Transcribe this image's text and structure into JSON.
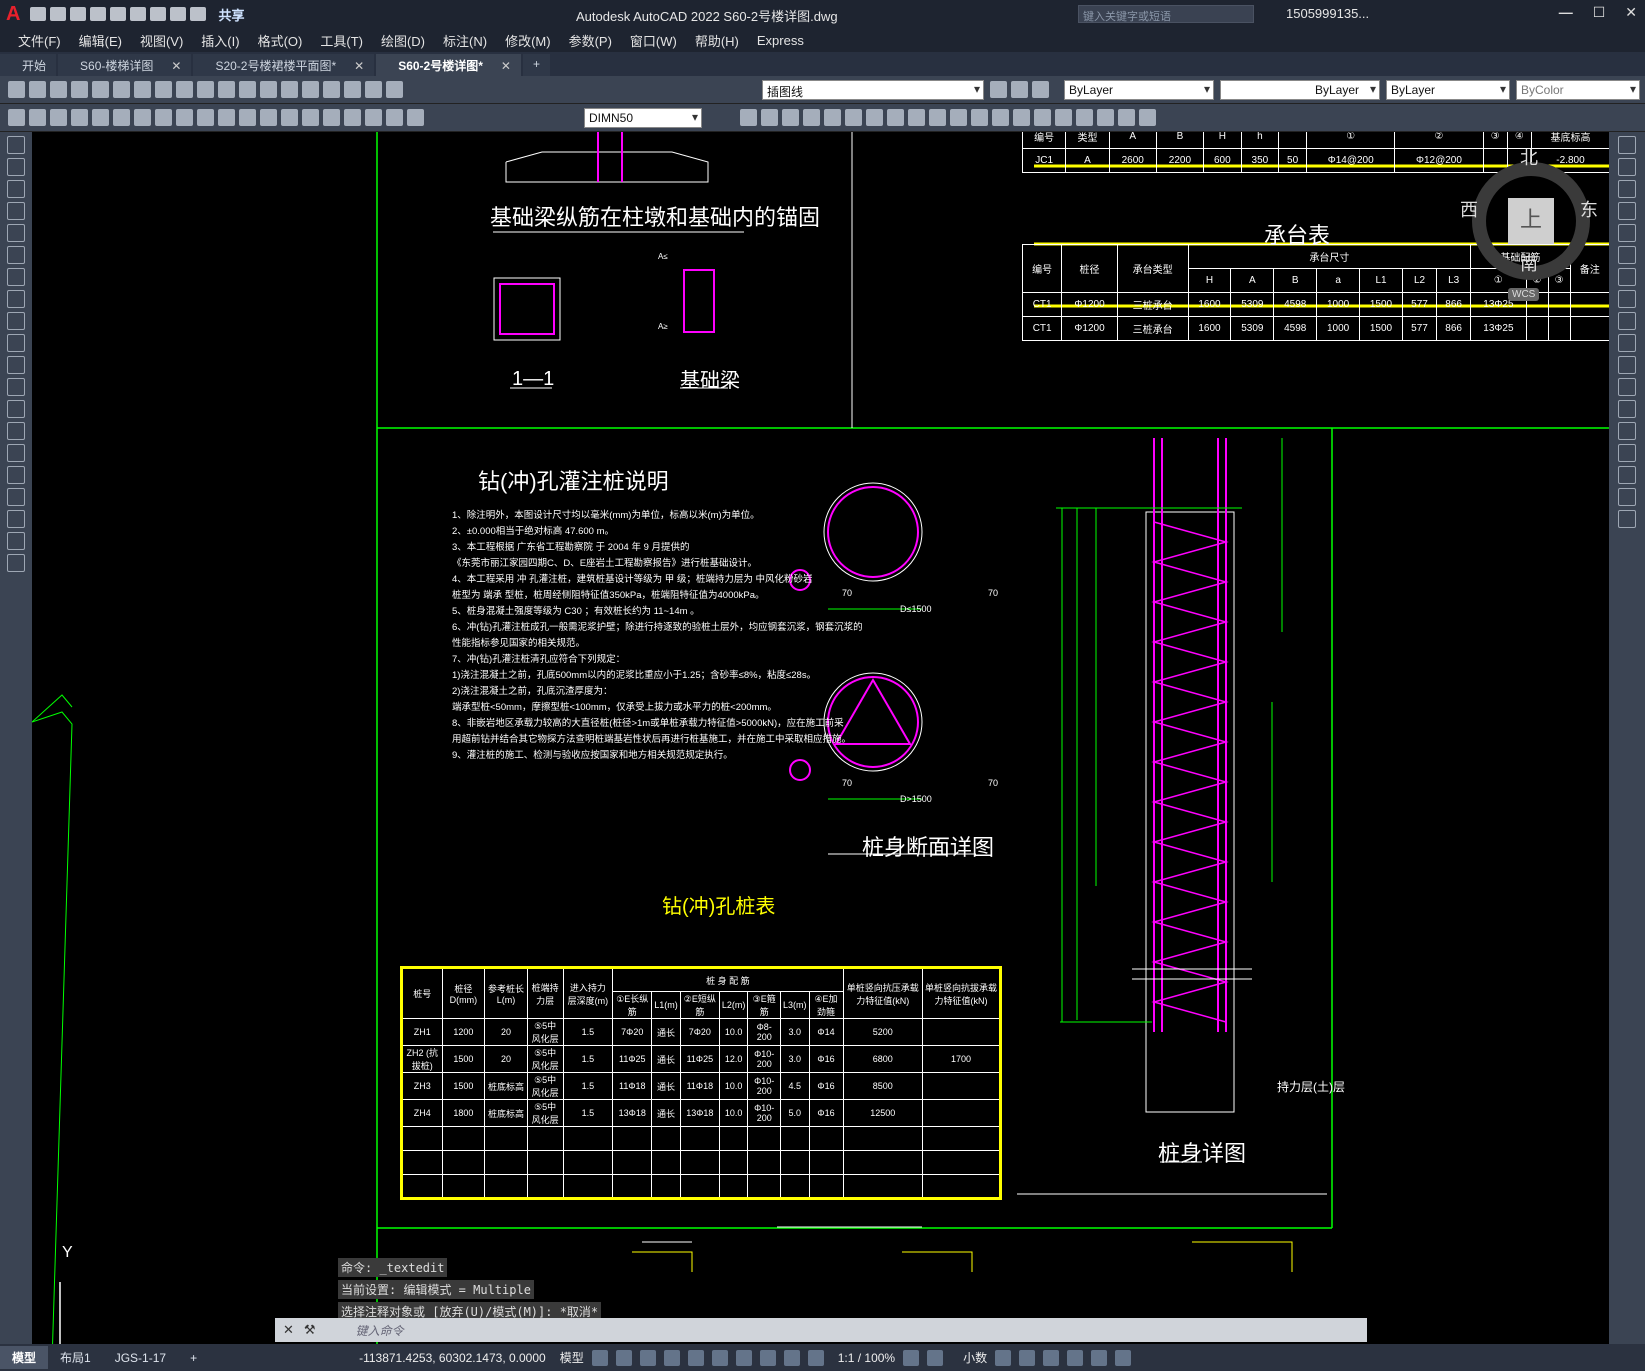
{
  "app": {
    "title": "Autodesk AutoCAD 2022    S60-2号楼详图.dwg",
    "share_label": "共享",
    "search_placeholder": "键入关键字或短语",
    "account": "1505999135...",
    "logo": "A"
  },
  "menu": [
    "文件(F)",
    "编辑(E)",
    "视图(V)",
    "插入(I)",
    "格式(O)",
    "工具(T)",
    "绘图(D)",
    "标注(N)",
    "修改(M)",
    "参数(P)",
    "窗口(W)",
    "帮助(H)",
    "Express"
  ],
  "tabs": [
    {
      "label": "开始"
    },
    {
      "label": "S60-楼梯详图"
    },
    {
      "label": "S20-2号楼裙楼平面图*"
    },
    {
      "label": "S60-2号楼详图*"
    }
  ],
  "toolbar": {
    "layer": "插图线",
    "color": "ByLayer",
    "linetype": "ByLayer",
    "lineweight": "ByLayer",
    "plotstyle": "ByColor",
    "dimstyle": "DIMN50"
  },
  "drawing": {
    "anchor_title": "基础梁纵筋在柱墩和基础内的锚固",
    "section_1": "1—1",
    "base_beam": "基础梁",
    "cap_table_title": "承台表",
    "pile_note_title": "钻(冲)孔灌注桩说明",
    "pile_section_title": "桩身断面详图",
    "pile_table_title": "钻(冲)孔桩表",
    "pile_detail_title": "桩身详图",
    "bearing_layer": "持力层(土)层",
    "d1500a": "D≤1500",
    "d1500b": "D>1500",
    "dim70": "70",
    "mini_a": "A≤",
    "mini_b": "A≥",
    "notes": [
      "1、除注明外，本图设计尺寸均以毫米(mm)为单位，标高以米(m)为单位。",
      "2、±0.000相当于绝对标高 47.600 m。",
      "3、本工程根据 广东省工程勘察院 于 2004 年 9 月提供的",
      "   《东莞市丽江家园四期C、D、E座岩土工程勘察报告》进行桩基础设计。",
      "4、本工程采用 冲 孔灌注桩，建筑桩基设计等级为 甲 级；桩端持力层为 中风化粉砂岩",
      "   桩型为 端承 型桩，桩周经侧阻特征值350kPa，桩端阻特征值为4000kPa。",
      "5、桩身混凝土强度等级为 C30 ；有效桩长约为 11~14m 。",
      "6、冲(钻)孔灌注桩成孔一般需泥浆护壁；除进行持逐致的验桩土层外，均应钢套沉浆，钢套沉浆的",
      "   性能指标参见国家的相关规范。",
      "7、冲(钻)孔灌注桩清孔应符合下列规定：",
      "   1)浇注混凝土之前，孔底500mm以内的泥浆比重应小于1.25；含砂率≤8%，粘度≤28s。",
      "   2)浇注混凝土之前，孔底沉渣厚度为：",
      "      端承型桩<50mm，摩擦型桩<100mm，仅承受上拔力或水平力的桩<200mm。",
      "8、非嵌岩地区承载力较高的大直径桩(桩径>1m或单桩承载力特征值>5000kN)，应在施工前采",
      "   用超前钻并结合其它物探方法查明桩端基岩性状后再进行桩基施工，并在施工中采取相应措施。",
      "9、灌注桩的施工、检测与验收应按国家和地方相关规范规定执行。"
    ],
    "jc_table": {
      "header": [
        "编号",
        "类型",
        "A",
        "B",
        "H",
        "h",
        "①",
        "②",
        "③",
        "④",
        "基底标高"
      ],
      "rows": [
        [
          "JC1",
          "A",
          "2600",
          "2200",
          "600",
          "350",
          "50",
          "Φ14@200",
          "Φ12@200",
          "",
          "",
          "-2.800"
        ]
      ]
    },
    "cap_table": {
      "header_top": [
        "编号",
        "桩径",
        "承台类型",
        "承台尺寸",
        "基础配筋",
        "备注"
      ],
      "header_sub": [
        "H",
        "A",
        "B",
        "a",
        "L1",
        "L2",
        "L3",
        "①",
        "②",
        "③"
      ],
      "rows": [
        [
          "CT1",
          "Φ1200",
          "三桩承台",
          "1600",
          "5309",
          "4598",
          "1000",
          "1500",
          "577",
          "866",
          "13Φ25",
          "",
          ""
        ],
        [
          "CT1",
          "Φ1200",
          "三桩承台",
          "1600",
          "5309",
          "4598",
          "1000",
          "1500",
          "577",
          "866",
          "13Φ25",
          "",
          ""
        ]
      ]
    },
    "pile_table": {
      "header": [
        "桩号",
        "桩径 D(mm)",
        "参考桩长 L(m)",
        "桩端持力层",
        "进入持力层深度(m)",
        "①E长纵筋",
        "L1(m)",
        "②E短纵筋",
        "L2(m)",
        "③E箍筋",
        "L3(m)",
        "④E加劲箍",
        "单桩竖向抗压承载力特征值(kN)",
        "单桩竖向抗拔承载力特征值(kN)"
      ],
      "group_header": "桩 身 配 筋",
      "rows": [
        [
          "ZH1",
          "1200",
          "20",
          "⑤5中风化层",
          "1.5",
          "7Φ20",
          "通长",
          "7Φ20",
          "10.0",
          "Φ8-200",
          "3.0",
          "Φ14",
          "5200",
          ""
        ],
        [
          "ZH2 (抗拔桩)",
          "1500",
          "20",
          "⑤5中风化层",
          "1.5",
          "11Φ25",
          "通长",
          "11Φ25",
          "12.0",
          "Φ10-200",
          "3.0",
          "Φ16",
          "6800",
          "1700"
        ],
        [
          "ZH3",
          "1500",
          "桩底标高",
          "⑤5中风化层",
          "1.5",
          "11Φ18",
          "通长",
          "11Φ18",
          "10.0",
          "Φ10-200",
          "4.5",
          "Φ16",
          "8500",
          ""
        ],
        [
          "ZH4",
          "1800",
          "桩底标高",
          "⑤5中风化层",
          "1.5",
          "13Φ18",
          "通长",
          "13Φ18",
          "10.0",
          "Φ10-200",
          "5.0",
          "Φ16",
          "12500",
          ""
        ]
      ]
    },
    "compass": {
      "n": "北",
      "s": "南",
      "e": "东",
      "w": "西",
      "top": "上",
      "ucs": "WCS"
    }
  },
  "command": {
    "history": [
      "命令: _textedit",
      "当前设置: 编辑模式 = Multiple",
      "选择注释对象或 [放弃(U)/模式(M)]: *取消*"
    ],
    "placeholder": "键入命令"
  },
  "status": {
    "layouts": [
      "模型",
      "布局1",
      "JGS-1-17"
    ],
    "coords": "-113871.4253, 60302.1473, 0.0000",
    "space": "模型",
    "scale": "1:1 / 100%",
    "units": "小数"
  },
  "ucs_icon": {
    "x": "X",
    "y": "Y"
  }
}
